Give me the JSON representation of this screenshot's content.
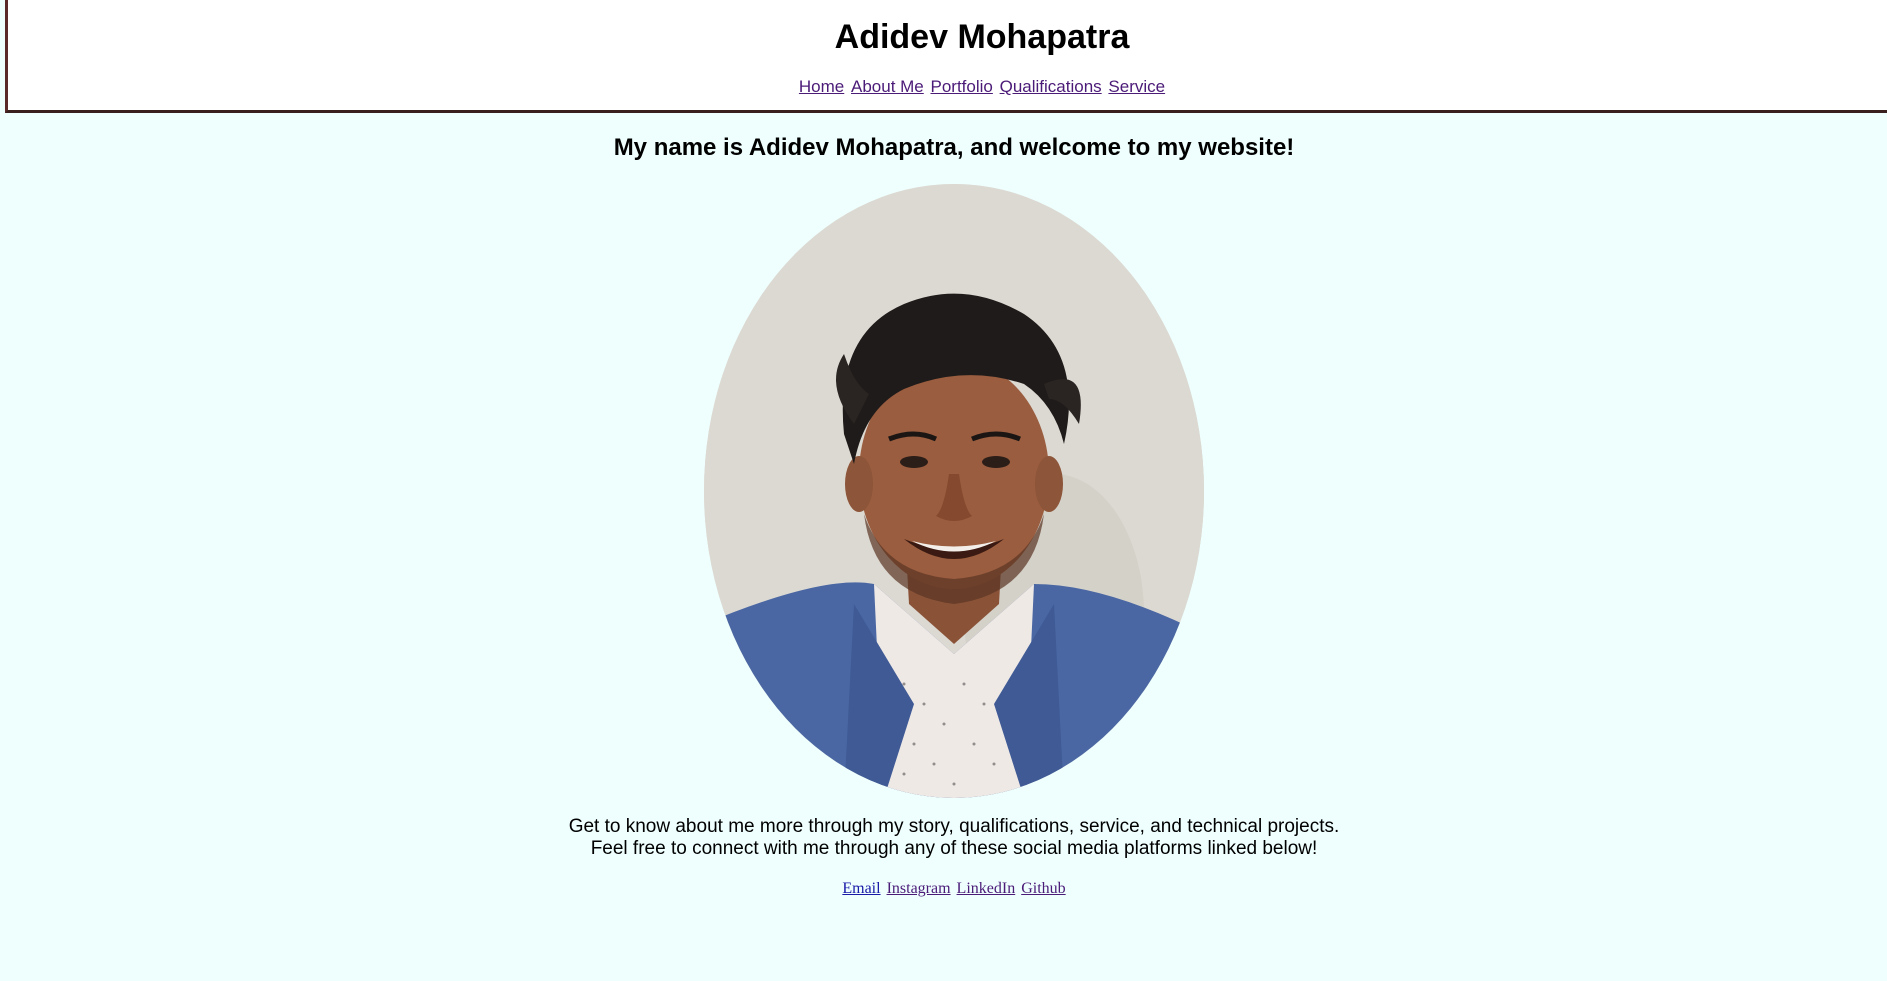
{
  "header": {
    "title": "Adidev Mohapatra",
    "nav": [
      {
        "label": "Home"
      },
      {
        "label": "About Me"
      },
      {
        "label": "Portfolio"
      },
      {
        "label": "Qualifications"
      },
      {
        "label": "Service"
      }
    ]
  },
  "main": {
    "welcome": "My name is Adidev Mohapatra, and welcome to my website!",
    "intro_line1": "Get to know about me more through my story, qualifications, service, and technical projects.",
    "intro_line2": "Feel free to connect with me through any of these social media platforms linked below!"
  },
  "social": [
    {
      "label": "Email"
    },
    {
      "label": "Instagram"
    },
    {
      "label": "LinkedIn"
    },
    {
      "label": "Github"
    }
  ],
  "colors": {
    "background": "#eefffe",
    "header_border": "#3a1f1f",
    "link_visited": "#4b1b78",
    "link_unvisited": "#1a1aa8"
  }
}
